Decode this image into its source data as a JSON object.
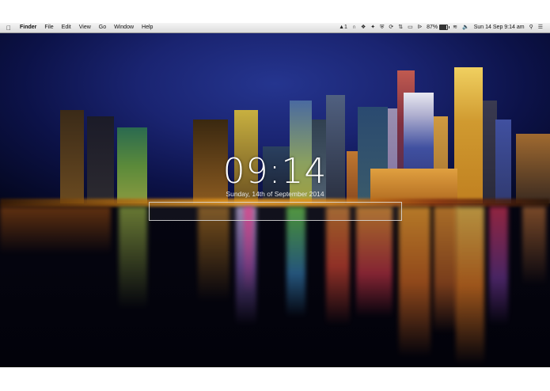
{
  "menubar": {
    "apple_icon": "apple-logo",
    "app_name": "Finder",
    "menus": [
      "File",
      "Edit",
      "View",
      "Go",
      "Window",
      "Help"
    ],
    "status": {
      "notification_count": "1",
      "battery_percent": "87%",
      "battery_level": 0.87,
      "datetime": "Sun 14 Sep  9:14 am"
    }
  },
  "clock": {
    "time": "09:14",
    "date": "Sunday, 14th of September 2014"
  }
}
